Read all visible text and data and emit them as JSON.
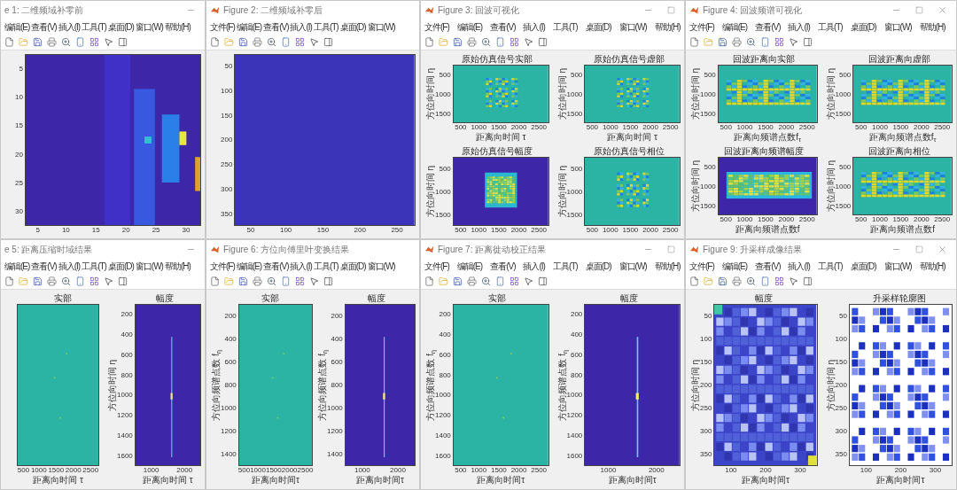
{
  "windows": [
    {
      "title": "e 1: 二维频域补零前",
      "app_icon": false,
      "controls": [
        {
          "kind": "minimize"
        }
      ],
      "menus": [
        "编辑(E)",
        "查看(V)",
        "插入(I)",
        "工具(T)",
        "桌面(D)",
        "窗口(W)",
        "帮助(H)"
      ],
      "plots": [
        {
          "yticks": [
            "5",
            "10",
            "15",
            "20",
            "25",
            "30"
          ],
          "xticks": [
            "5",
            "10",
            "15",
            "20",
            "25",
            "30"
          ],
          "kind": "heat"
        }
      ]
    },
    {
      "title": "Figure 2: 二维频域补零后",
      "app_icon": true,
      "menus": [
        "文件(F)",
        "编辑(E)",
        "查看(V)",
        "插入(I)",
        "工具(T)",
        "桌面(D)",
        "窗口(W)"
      ],
      "plots": [
        {
          "yticks": [
            "50",
            "100",
            "150",
            "200",
            "250",
            "300",
            "350"
          ],
          "xticks": [
            "50",
            "100",
            "150",
            "200",
            "250"
          ],
          "kind": "flat"
        }
      ]
    },
    {
      "title": "Figure 3: 回波可视化",
      "app_icon": true,
      "controls": [
        {
          "kind": "minimize"
        },
        {
          "kind": "maximize"
        }
      ],
      "menus": [
        "文件(F)",
        "编辑(E)",
        "查看(V)",
        "插入(I)",
        "工具(T)",
        "桌面(D)",
        "窗口(W)",
        "帮助(H)"
      ],
      "plots": [
        {
          "title": "原始仿真信号实部",
          "ylabel": "方位向时间 η",
          "yticks": [
            "500",
            "1000",
            "1500"
          ],
          "xticks": [
            "500",
            "1000",
            "1500",
            "2000",
            "2500"
          ],
          "xlabel": "距离向时间 τ",
          "kind": "noise"
        },
        {
          "title": "原始仿真信号虚部",
          "ylabel": "方位向时间 η",
          "yticks": [
            "500",
            "1000",
            "1500"
          ],
          "xticks": [
            "500",
            "1000",
            "1500",
            "2000",
            "2500"
          ],
          "xlabel": "距离向时间 τ",
          "kind": "noise"
        },
        {
          "title": "原始仿真信号幅度",
          "ylabel": "方位向时间 η",
          "yticks": [
            "500",
            "1000",
            "1500"
          ],
          "xticks": [
            "500",
            "1000",
            "1500",
            "2000",
            "2500"
          ],
          "kind": "box"
        },
        {
          "title": "原始仿真信号相位",
          "ylabel": "方位向时间 η",
          "yticks": [
            "500",
            "1000",
            "1500"
          ],
          "xticks": [
            "500",
            "1000",
            "1500",
            "2000",
            "2500"
          ],
          "kind": "noise"
        }
      ]
    },
    {
      "title": "Figure 4: 回波频谱可视化",
      "app_icon": true,
      "controls": [
        {
          "kind": "minimize"
        },
        {
          "kind": "maximize"
        },
        {
          "kind": "close"
        }
      ],
      "menus": [
        "文件(F)",
        "编辑(E)",
        "查看(V)",
        "插入(I)",
        "工具(T)",
        "桌面(D)",
        "窗口(W)",
        "帮助(H)"
      ],
      "plots": [
        {
          "title": "回波距离向实部",
          "ylabel": "方位向时间 η",
          "yticks": [
            "500",
            "1000",
            "1500"
          ],
          "xticks": [
            "500",
            "1000",
            "1500",
            "2000",
            "2500"
          ],
          "xlabel": "距离向频谱点数f$_{τ}$",
          "kind": "band"
        },
        {
          "title": "回波距离向虚部",
          "ylabel": "方位向时间 η",
          "yticks": [
            "500",
            "1000",
            "1500"
          ],
          "xticks": [
            "500",
            "1000",
            "1500",
            "2000",
            "2500"
          ],
          "xlabel": "距离向频谱点数f$_{τ}$",
          "kind": "band"
        },
        {
          "title": "回波距离向频谱幅度",
          "ylabel": "方位向时间 η",
          "yticks": [
            "500",
            "1000",
            "1500"
          ],
          "xticks": [
            "500",
            "1000",
            "1500",
            "2000",
            "2500"
          ],
          "xlabel": "距离向频谱点数f",
          "kind": "boxband"
        },
        {
          "title": "回波距离向相位",
          "ylabel": "方位向时间 η",
          "yticks": [
            "500",
            "1000",
            "1500"
          ],
          "xticks": [
            "500",
            "1000",
            "1500",
            "2000",
            "2500"
          ],
          "xlabel": "距离向频谱点数f",
          "kind": "band"
        }
      ]
    },
    {
      "title": "e 5: 距离压缩时域结果",
      "app_icon": false,
      "controls": [
        {
          "kind": "minimize"
        }
      ],
      "menus": [
        "编辑(E)",
        "查看(V)",
        "插入(I)",
        "工具(T)",
        "桌面(D)",
        "窗口(W)",
        "帮助(H)"
      ],
      "plots": [
        {
          "title": "实部",
          "xticks": [
            "500",
            "1000",
            "1500",
            "2000",
            "2500"
          ],
          "xlabel": "距离向时间 τ",
          "kind": "sparse"
        },
        {
          "title": "幅度",
          "ylabel": "方位向时间 η",
          "yticks": [
            "200",
            "400",
            "600",
            "800",
            "1000",
            "1200",
            "1400",
            "1600"
          ],
          "xticks": [
            "1000",
            "2000"
          ],
          "xlabel": "距离向时间 τ",
          "kind": "line"
        }
      ]
    },
    {
      "title": "Figure 6: 方位向傅里叶变换结果",
      "app_icon": true,
      "menus": [
        "文件(F)",
        "编辑(E)",
        "查看(V)",
        "插入(I)",
        "工具(T)",
        "桌面(D)",
        "窗口(W)"
      ],
      "plots": [
        {
          "title": "实部",
          "ylabel": "方位向频谱点数 f$_{η}$",
          "yticks": [
            "200",
            "400",
            "600",
            "800",
            "1000",
            "1200",
            "1400"
          ],
          "xticks": [
            "500",
            "1000",
            "1500",
            "2000",
            "2500"
          ],
          "xlabel": "距离向时间τ",
          "kind": "sparse"
        },
        {
          "title": "幅度",
          "ylabel": "方位向频谱点数 f$_{η}$",
          "yticks": [
            "200",
            "400",
            "600",
            "800",
            "1000",
            "1200",
            "1400"
          ],
          "xticks": [
            "1000",
            "2000"
          ],
          "xlabel": "距离向时间τ",
          "kind": "line"
        }
      ]
    },
    {
      "title": "Figure 7: 距离徙动校正结果",
      "app_icon": true,
      "controls": [
        {
          "kind": "minimize"
        },
        {
          "kind": "maximize"
        }
      ],
      "menus": [
        "文件(F)",
        "编辑(E)",
        "查看(V)",
        "插入(I)",
        "工具(T)",
        "桌面(D)",
        "窗口(W)",
        "帮助(H)"
      ],
      "plots": [
        {
          "title": "实部",
          "ylabel": "方位向频谱点数 f$_{η}$",
          "yticks": [
            "200",
            "400",
            "600",
            "800",
            "1000",
            "1200",
            "1400",
            "1600"
          ],
          "xticks": [
            "500",
            "1000",
            "1500",
            "2000",
            "2500"
          ],
          "xlabel": "距离向时间τ",
          "kind": "sparse"
        },
        {
          "title": "幅度",
          "ylabel": "方位向频谱点数 f$_{η}$",
          "yticks": [
            "200",
            "400",
            "600",
            "800",
            "1000",
            "1200",
            "1400",
            "1600"
          ],
          "xticks": [
            "1000",
            "2000"
          ],
          "xlabel": "距离向时间τ",
          "kind": "line"
        }
      ]
    },
    {
      "title": "Figure 9: 升采样成像结果",
      "app_icon": true,
      "controls": [
        {
          "kind": "minimize"
        },
        {
          "kind": "maximize"
        },
        {
          "kind": "close"
        }
      ],
      "menus": [
        "文件(F)",
        "编辑(E)",
        "查看(V)",
        "插入(I)",
        "工具(T)",
        "桌面(D)",
        "窗口(W)",
        "帮助(H)"
      ],
      "plots": [
        {
          "title": "幅度",
          "ylabel": "方位向时间 η",
          "yticks": [
            "50",
            "100",
            "150",
            "200",
            "250",
            "300",
            "350"
          ],
          "xticks": [
            "100",
            "200",
            "300"
          ],
          "xlabel": "距离向时间τ",
          "kind": "texture"
        },
        {
          "title": "升采样轮廓图",
          "ylabel": "方位向时间 η",
          "yticks": [
            "50",
            "100",
            "150",
            "200",
            "250",
            "300",
            "350"
          ],
          "xticks": [
            "100",
            "200",
            "300"
          ],
          "xlabel": "距离向时间τ",
          "kind": "contour"
        }
      ]
    }
  ]
}
